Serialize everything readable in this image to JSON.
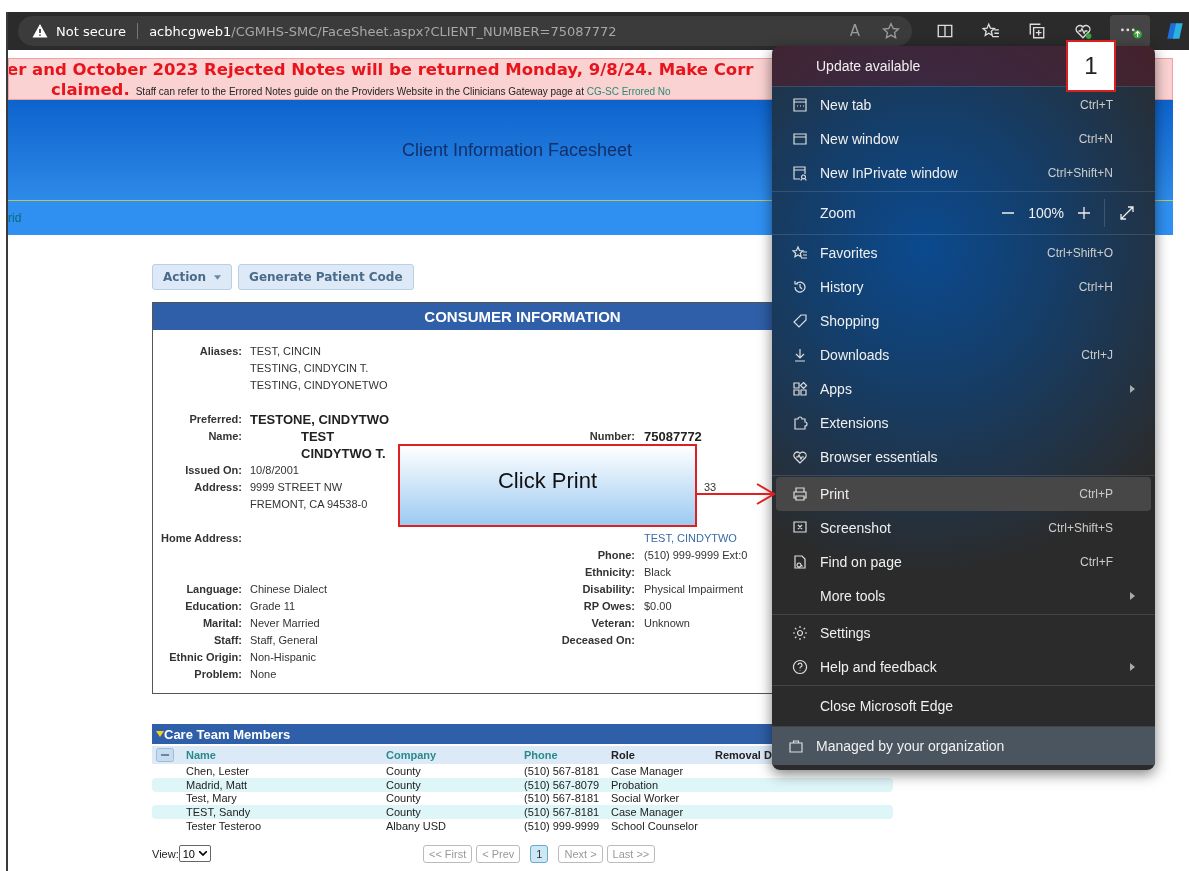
{
  "browser": {
    "security": "Not secure",
    "url": "**acbhcgweb1**/CGMHS-SMC/FaceSheet.aspx?CLIENT_NUMBER=75087772",
    "read_aloud": "A"
  },
  "banner": {
    "headline": "er and October 2023 Rejected Notes will be returned Monday, 9/8/24. Make Corr",
    "headline_end": "claimed.",
    "note": "Staff can refer to the Errored Notes guide on the Providers Website in the Clinicians Gateway page at",
    "link": "CG-SC Errored No"
  },
  "header": {
    "title": "Client Information Facesheet",
    "nav_fragment": "rid"
  },
  "actions": [
    {
      "label": "Action",
      "dropdown": true
    },
    {
      "label": "Generate Patient Code",
      "dropdown": false
    }
  ],
  "consumer_information": {
    "title": "CONSUMER INFORMATION",
    "rows": [
      {
        "label": "Aliases:",
        "value": "TEST, CINCIN",
        "kind": "plain"
      },
      {
        "value": "TESTING, CINDYCIN T.",
        "kind": "plain"
      },
      {
        "value": "TESTING, CINDYONETWO",
        "kind": "plain"
      },
      {
        "kind": "gap"
      },
      {
        "label": "Preferred:",
        "value": "TESTONE, CINDYTWO",
        "kind": "name"
      },
      {
        "label": "Name:",
        "value": "TEST",
        "kind": "name_indent",
        "right": {
          "label": "Number:",
          "value": "75087772",
          "kind": "strong"
        }
      },
      {
        "value": "CINDYTWO T.",
        "kind": "name_indent"
      },
      {
        "label": "Issued On:",
        "value": "10/8/2001",
        "kind": "plain"
      },
      {
        "label": "Address:",
        "value": "9999 STREET NW",
        "kind": "plain",
        "right": {
          "value": "33",
          "kind": "fragment"
        }
      },
      {
        "value": "FREMONT, CA 94538-0",
        "kind": "plain"
      },
      {
        "kind": "gap"
      },
      {
        "label": "Home Address:",
        "kind": "plain",
        "right": {
          "value": "TEST, CINDYTWO",
          "kind": "link"
        }
      },
      {
        "kind": "plain",
        "right": {
          "label": "Phone:",
          "value": "(510) 999-9999 Ext:0",
          "kind": "plain"
        }
      },
      {
        "kind": "plain",
        "right": {
          "label": "Ethnicity:",
          "value": "Black",
          "kind": "plain"
        }
      },
      {
        "label": "Language:",
        "value": "Chinese Dialect",
        "kind": "plain",
        "right": {
          "label": "Disability:",
          "value": "Physical Impairment",
          "kind": "plain"
        }
      },
      {
        "label": "Education:",
        "value": "Grade 11",
        "kind": "plain",
        "right": {
          "label": "RP Owes:",
          "value": "$0.00",
          "kind": "plain"
        }
      },
      {
        "label": "Marital:",
        "value": "Never Married",
        "kind": "plain",
        "right": {
          "label": "Veteran:",
          "value": "Unknown",
          "kind": "plain"
        }
      },
      {
        "label": "Staff:",
        "value": "Staff, General",
        "kind": "plain",
        "right": {
          "label": "Deceased On:",
          "kind": "plain"
        }
      },
      {
        "label": "Ethnic Origin:",
        "value": "Non-Hispanic",
        "kind": "plain"
      },
      {
        "label": "Problem:",
        "value": "None",
        "kind": "plain"
      }
    ]
  },
  "care_team": {
    "title": "Care Team Members",
    "expanded": true,
    "columns": [
      {
        "label": "Name",
        "sortable": true
      },
      {
        "label": "Company",
        "sortable": true
      },
      {
        "label": "Phone",
        "sortable": true
      },
      {
        "label": "Role",
        "sortable": false
      },
      {
        "label": "Removal D",
        "sortable": false
      }
    ],
    "rows": [
      [
        "Chen, Lester",
        "County",
        "(510) 567-8181",
        "Case Manager"
      ],
      [
        "Madrid, Matt",
        "County",
        "(510) 567-8079",
        "Probation"
      ],
      [
        "Test, Mary",
        "County",
        "(510) 567-8181",
        "Social Worker"
      ],
      [
        "TEST, Sandy",
        "County",
        "(510) 567-8181",
        "Case Manager"
      ],
      [
        "Tester Testeroo",
        "Albany USD",
        "(510) 999-9999",
        "School Counselor"
      ]
    ],
    "view": {
      "label": "View:",
      "value": "10"
    },
    "pager": [
      {
        "label": "<< First",
        "disabled": true,
        "selected": false
      },
      {
        "label": "< Prev",
        "disabled": true,
        "selected": false
      },
      {
        "label": "1",
        "disabled": false,
        "selected": true
      },
      {
        "label": "Next >",
        "disabled": true,
        "selected": false
      },
      {
        "label": "Last >>",
        "disabled": true,
        "selected": false
      }
    ]
  },
  "menu": {
    "groups": [
      [
        {
          "kind": "update",
          "label": "Update available",
          "selected": false
        }
      ],
      [
        {
          "kind": "item",
          "label": "New tab",
          "shortcut": "Ctrl+T",
          "selected": false
        },
        {
          "kind": "item",
          "label": "New window",
          "shortcut": "Ctrl+N",
          "selected": false
        },
        {
          "kind": "item",
          "label": "New InPrivate window",
          "shortcut": "Ctrl+Shift+N",
          "selected": false
        }
      ],
      [
        {
          "kind": "zoom",
          "label": "Zoom",
          "value": "100%"
        }
      ],
      [
        {
          "kind": "item",
          "label": "Favorites",
          "shortcut": "Ctrl+Shift+O",
          "selected": false
        },
        {
          "kind": "item",
          "label": "History",
          "shortcut": "Ctrl+H",
          "selected": false
        },
        {
          "kind": "item",
          "label": "Shopping",
          "selected": false
        },
        {
          "kind": "item",
          "label": "Downloads",
          "shortcut": "Ctrl+J",
          "selected": false
        },
        {
          "kind": "item",
          "label": "Apps",
          "submenu": true,
          "selected": false
        },
        {
          "kind": "item",
          "label": "Extensions",
          "selected": false
        },
        {
          "kind": "item",
          "label": "Browser essentials",
          "selected": false
        }
      ],
      [
        {
          "kind": "item",
          "label": "Print",
          "shortcut": "Ctrl+P",
          "selected": true
        },
        {
          "kind": "item",
          "label": "Screenshot",
          "shortcut": "Ctrl+Shift+S",
          "selected": false
        },
        {
          "kind": "item",
          "label": "Find on page",
          "shortcut": "Ctrl+F",
          "selected": false
        },
        {
          "kind": "item",
          "label": "More tools",
          "submenu": true,
          "selected": false
        }
      ],
      [
        {
          "kind": "item",
          "label": "Settings",
          "selected": false
        },
        {
          "kind": "item",
          "label": "Help and feedback",
          "submenu": true,
          "selected": false
        }
      ],
      [
        {
          "kind": "item",
          "label": "Close Microsoft Edge",
          "selected": false
        }
      ],
      [
        {
          "kind": "footer",
          "label": "Managed by your organization",
          "selected": false
        }
      ]
    ]
  },
  "annotations": [
    {
      "kind": "step",
      "text": "1"
    },
    {
      "kind": "callout",
      "text": "Click Print"
    }
  ]
}
